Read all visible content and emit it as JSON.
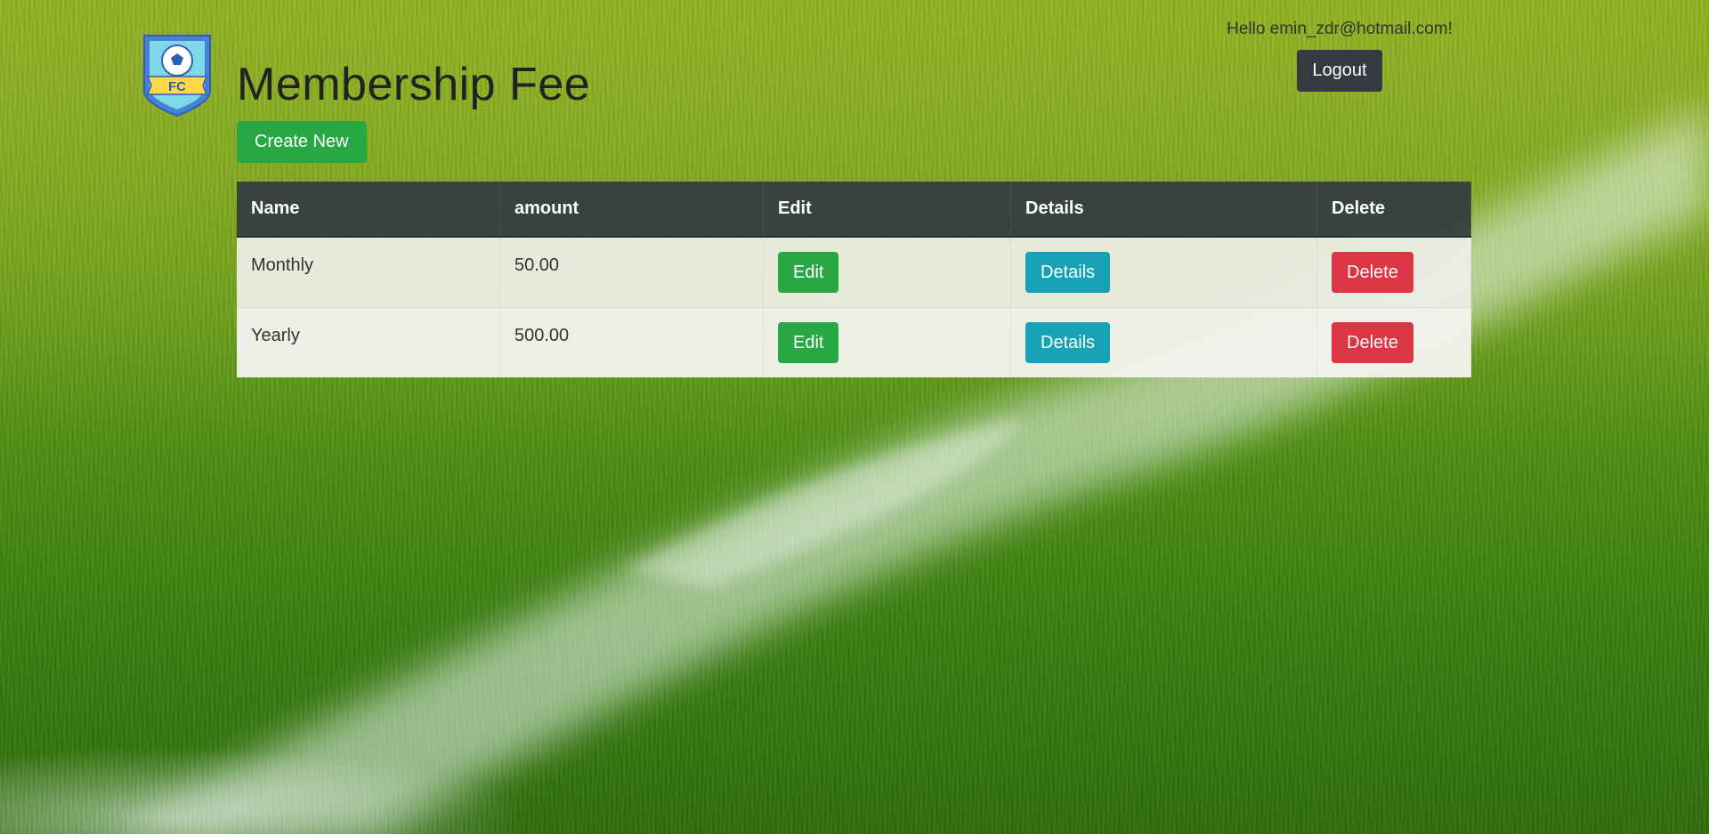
{
  "page": {
    "title": "Membership Fee",
    "create_label": "Create New"
  },
  "user": {
    "greeting": "Hello emin_zdr@hotmail.com!",
    "logout_label": "Logout"
  },
  "logo": {
    "text": "FC"
  },
  "table": {
    "headers": {
      "name": "Name",
      "amount": "amount",
      "edit": "Edit",
      "details": "Details",
      "delete": "Delete"
    },
    "rows": [
      {
        "name": "Monthly",
        "amount": "50.00",
        "edit_label": "Edit",
        "details_label": "Details",
        "delete_label": "Delete"
      },
      {
        "name": "Yearly",
        "amount": "500.00",
        "edit_label": "Edit",
        "details_label": "Details",
        "delete_label": "Delete"
      }
    ]
  },
  "colors": {
    "success": "#28a745",
    "info": "#17a2b8",
    "danger": "#dc3545",
    "dark": "#343a40"
  }
}
